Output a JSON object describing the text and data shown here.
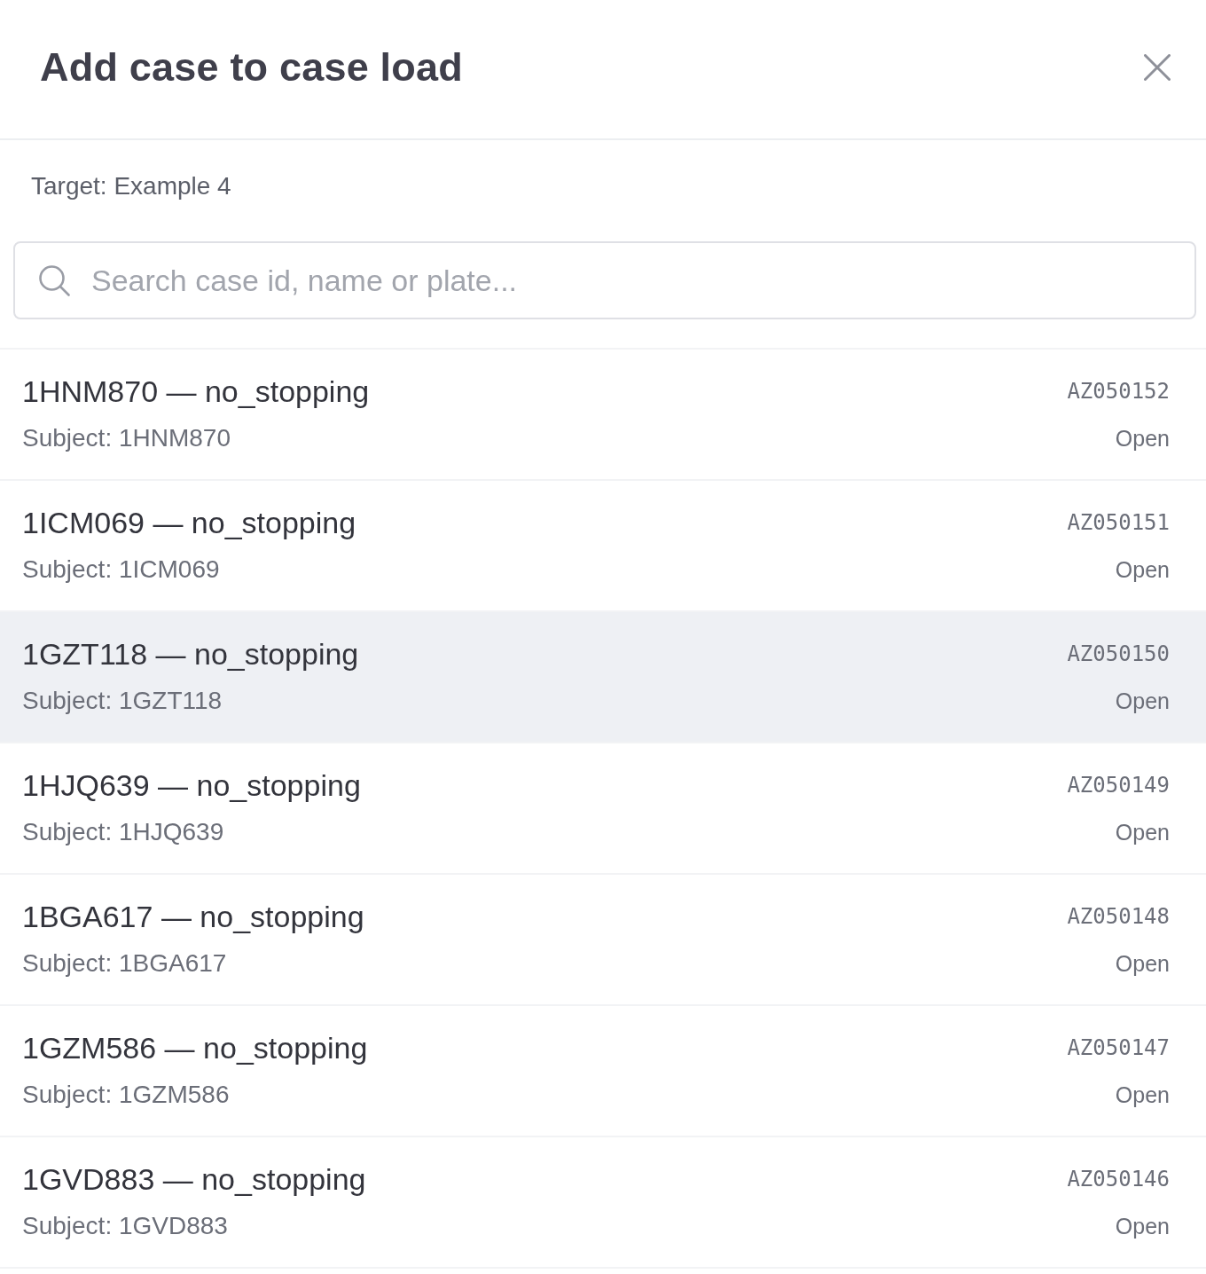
{
  "dialog": {
    "title": "Add case to case load"
  },
  "target": "Target: Example 4",
  "search": {
    "placeholder": "Search case id, name or plate..."
  },
  "cases": [
    {
      "title": "1HNM870 — no_stopping",
      "subject": "Subject: 1HNM870",
      "case_id": "AZ050152",
      "status": "Open",
      "selected": false
    },
    {
      "title": "1ICM069 — no_stopping",
      "subject": "Subject: 1ICM069",
      "case_id": "AZ050151",
      "status": "Open",
      "selected": false
    },
    {
      "title": "1GZT118 — no_stopping",
      "subject": "Subject: 1GZT118",
      "case_id": "AZ050150",
      "status": "Open",
      "selected": true
    },
    {
      "title": "1HJQ639 — no_stopping",
      "subject": "Subject: 1HJQ639",
      "case_id": "AZ050149",
      "status": "Open",
      "selected": false
    },
    {
      "title": "1BGA617 — no_stopping",
      "subject": "Subject: 1BGA617",
      "case_id": "AZ050148",
      "status": "Open",
      "selected": false
    },
    {
      "title": "1GZM586 — no_stopping",
      "subject": "Subject: 1GZM586",
      "case_id": "AZ050147",
      "status": "Open",
      "selected": false
    },
    {
      "title": "1GVD883 — no_stopping",
      "subject": "Subject: 1GVD883",
      "case_id": "AZ050146",
      "status": "Open",
      "selected": false
    }
  ]
}
